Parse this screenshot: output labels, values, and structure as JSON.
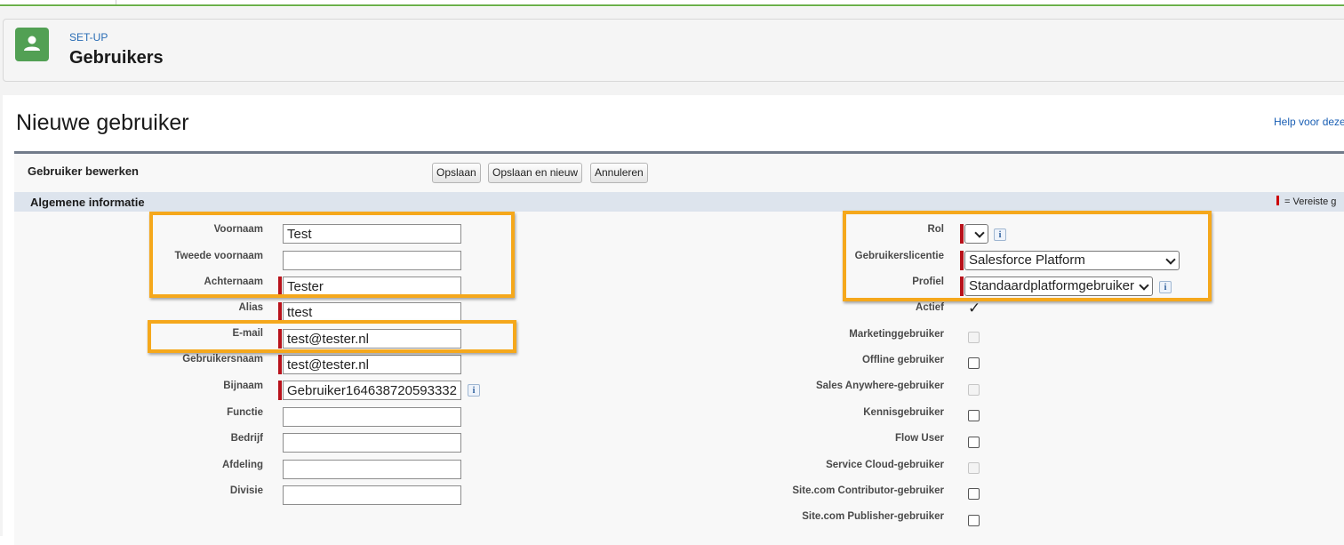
{
  "header": {
    "breadcrumb": "SET-UP",
    "title": "Gebruikers",
    "icon": "user-icon",
    "icon_color": "#52a054"
  },
  "page": {
    "title": "Nieuwe gebruiker",
    "help_link": "Help voor deze"
  },
  "edit_block": {
    "title": "Gebruiker bewerken",
    "buttons": {
      "save": "Opslaan",
      "save_new": "Opslaan en nieuw",
      "cancel": "Annuleren"
    }
  },
  "section": {
    "title": "Algemene informatie",
    "required_note": "= Vereiste g"
  },
  "left_fields": {
    "first_name": {
      "label": "Voornaam",
      "value": "Test"
    },
    "middle_name": {
      "label": "Tweede voornaam",
      "value": ""
    },
    "last_name": {
      "label": "Achternaam",
      "value": "Tester"
    },
    "alias": {
      "label": "Alias",
      "value": "ttest"
    },
    "email": {
      "label": "E-mail",
      "value": "test@tester.nl"
    },
    "username": {
      "label": "Gebruikersnaam",
      "value": "test@tester.nl"
    },
    "nickname": {
      "label": "Bijnaam",
      "value": "Gebruiker164638720593332"
    },
    "function": {
      "label": "Functie",
      "value": ""
    },
    "company": {
      "label": "Bedrijf",
      "value": ""
    },
    "department": {
      "label": "Afdeling",
      "value": ""
    },
    "division": {
      "label": "Divisie",
      "value": ""
    }
  },
  "right_fields": {
    "role": {
      "label": "Rol",
      "value": ""
    },
    "license": {
      "label": "Gebruikerslicentie",
      "value": "Salesforce Platform"
    },
    "profile": {
      "label": "Profiel",
      "value": "Standaardplatformgebruiker"
    },
    "active": {
      "label": "Actief",
      "checked": true
    },
    "marketing": {
      "label": "Marketinggebruiker",
      "checked": false,
      "disabled": true
    },
    "offline": {
      "label": "Offline gebruiker",
      "checked": false
    },
    "sales_anywhere": {
      "label": "Sales Anywhere-gebruiker",
      "checked": false,
      "disabled": true
    },
    "knowledge": {
      "label": "Kennisgebruiker",
      "checked": false
    },
    "flow": {
      "label": "Flow User",
      "checked": false
    },
    "service_cloud": {
      "label": "Service Cloud-gebruiker",
      "checked": false,
      "disabled": true
    },
    "site_contributor": {
      "label": "Site.com Contributor-gebruiker",
      "checked": false
    },
    "site_publisher": {
      "label": "Site.com Publisher-gebruiker",
      "checked": false
    }
  },
  "colors": {
    "highlight": "#f5a81c",
    "required": "#b8121b",
    "link": "#1a5fb4"
  }
}
